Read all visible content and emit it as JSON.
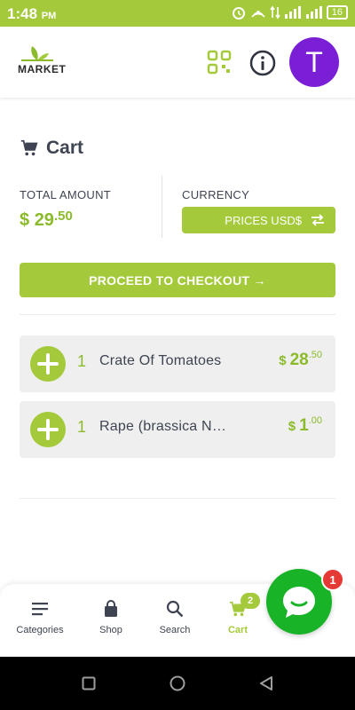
{
  "status_bar": {
    "time": "1:48",
    "ampm": "PM",
    "battery": "16"
  },
  "header": {
    "logo_text": "MARKET",
    "avatar_initial": "T"
  },
  "cart": {
    "title": "Cart",
    "total_label": "TOTAL AMOUNT",
    "total_currency": "$",
    "total_whole": "29",
    "total_cents": ".50",
    "currency_label": "CURRENCY",
    "currency_button": "PRICES USD$",
    "checkout_button": "PROCEED TO CHECKOUT →"
  },
  "items": [
    {
      "qty": "1",
      "name": "Crate Of Tomatoes",
      "currency": "$",
      "price_whole": "28",
      "price_cents": ".50"
    },
    {
      "qty": "1",
      "name": "Rape (brassica Napus)",
      "currency": "$",
      "price_whole": "1",
      "price_cents": ".00"
    }
  ],
  "nav": {
    "categories": "Categories",
    "shop": "Shop",
    "search": "Search",
    "cart": "Cart",
    "cart_badge": "2"
  },
  "chat": {
    "badge": "1"
  },
  "colors": {
    "accent": "#a4c93a",
    "accent_text": "#8bbb2a",
    "avatar": "#7b1fd6",
    "chat": "#19b328",
    "badge": "#e53935"
  }
}
